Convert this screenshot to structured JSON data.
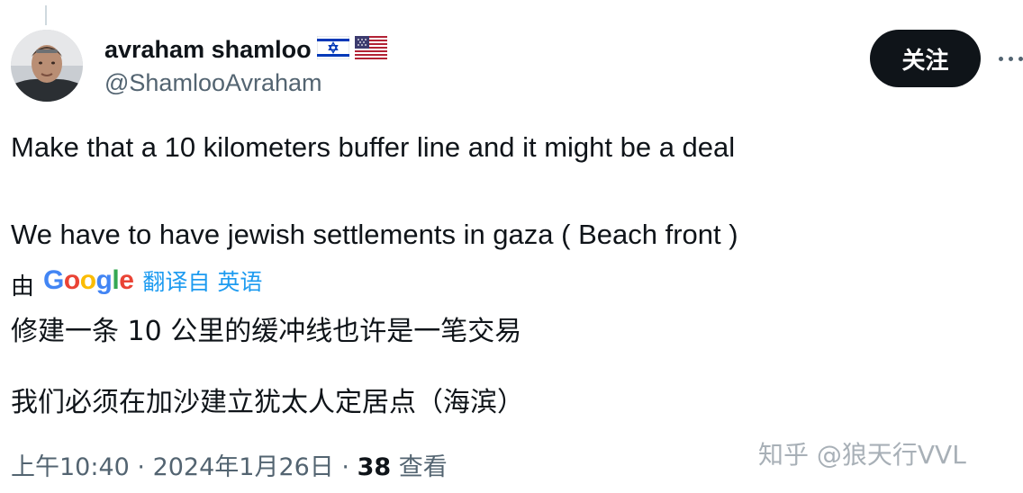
{
  "author": {
    "display_name": "avraham shamloo",
    "handle": "@ShamlooAvraham",
    "flags": [
      "israel-flag-icon",
      "usa-flag-icon"
    ]
  },
  "follow_button": {
    "label": "关注"
  },
  "more_button": {
    "icon": "more-horizontal-icon"
  },
  "tweet": {
    "line1": "Make that a 10 kilometers buffer line and it might be a deal",
    "line2": "We have to have jewish settlements in gaza ( Beach front )"
  },
  "translation": {
    "by": "由",
    "provider_logo": "Google",
    "translated_from": "翻译自 英语",
    "line1": "修建一条 10 公里的缓冲线也许是一笔交易",
    "line2": "我们必须在加沙建立犹太人定居点（海滨）"
  },
  "meta": {
    "time": "上午10:40",
    "separator": " · ",
    "date": "2024年1月26日",
    "views_count": "38",
    "views_label": " 查看"
  },
  "watermark": "知乎 @狼天行VVL",
  "colors": {
    "text_primary": "#0f1419",
    "text_secondary": "#536471",
    "accent_link": "#1d9bf0",
    "follow_bg": "#0f1419"
  }
}
